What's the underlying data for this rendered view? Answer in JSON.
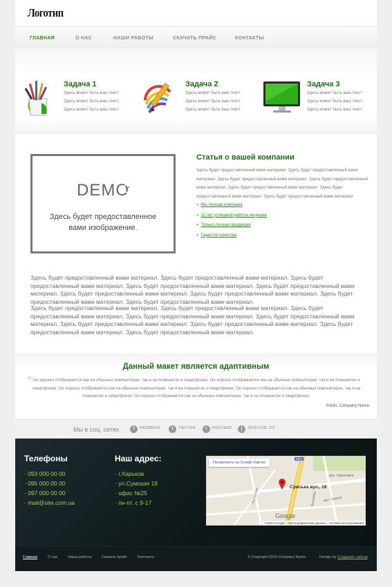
{
  "logo": "Логотип",
  "nav": [
    {
      "label": "ГЛАВНАЯ",
      "active": true
    },
    {
      "label": "О НАС"
    },
    {
      "label": "НАШИ РАБОТЫ"
    },
    {
      "label": "СКАЧАТЬ ПРАЙС"
    },
    {
      "label": "КОНТАКТЫ"
    }
  ],
  "tasks": [
    {
      "title": "Задача 1",
      "icon": "paintbrushes-icon",
      "lines": [
        "Здесь может быть ваш текст",
        "Здесь может быть ваш текст",
        "Здесь может быть ваш текст"
      ]
    },
    {
      "title": "Задача 2",
      "icon": "pencil-palette-icon",
      "lines": [
        "Здесь может быть ваш текст",
        "Здесь может быть ваш текст",
        "Здесь может быть ваш текст"
      ]
    },
    {
      "title": "Задача 3",
      "icon": "monitor-icon",
      "lines": [
        "Здесь может быть ваш текст",
        "Здесь может быть ваш текст",
        "Здесь может быть ваш текст"
      ]
    }
  ],
  "demo": {
    "word": "DEMO",
    "caption_1": "Здесь будет предоставленное",
    "caption_2": "вами изображение."
  },
  "article": {
    "title": "Статья о вашей компании",
    "text": "Здесь будет предоставленный вами материал. Здесь будет предоставленный вами материал. Здесь будет предоставленный вами материал. Здесь будет предоставленный вами материал. Здесь будет предоставленный вами материал. Здесь будет предоставленный вами материал. Здесь будет предоставленный вами материал.",
    "links": [
      "Мы лучшая компания",
      "12 лет успешной работы на рынке",
      "Только лучшая продукция",
      "Гарантия качества"
    ]
  },
  "paragraphs": [
    "Здесь будет предоставленный вами материал. Здесь будет предоставленный вами материал. Здесь будет предоставленный вами материал. Здесь будет предоставленный вами материал. Здесь будет предоставленный вами материал. Здесь будет предоставленный вами материал. Здесь будет предоставленный вами материал. Здесь будет предоставленный вами материал. Здесь будет предоставленный вами материал.",
    "Здесь будет предоставленный вами материал. Здесь будет предоставленный вами материал. Здесь будет предоставленный вами материал. Здесь будет предоставленный вами материал. Здесь будет предоставленный вами материал. Здесь будет предоставленный вами материал. Здесь будет предоставленный вами материал. Здесь будет предоставленный вами материал. Здесь будет предоставленный вами материал."
  ],
  "quote": {
    "title": "Данный макет является адаптивным",
    "text": "Он хорошо отображается как на обычных компьютерах, так и на планшетах и смартфонах. Он хорошо отображается как на обычных компьютерах, так и на планшетах и смартфонах. Он хорошо отображается как на обычных компьютерах, так и на планшетах и смартфонах. Он хорошо отображается как на обычных компьютерах, так и на планшетах и смартфонах. Он хорошо отображается как на обычных компьютерах, так и на планшетах и смартфонах.",
    "author": "Anton, Company Name"
  },
  "social": {
    "label": "Мы в соц. сетях",
    "items": [
      {
        "icon": "facebook-icon",
        "glyph": "f",
        "label": "FACEBOOK"
      },
      {
        "icon": "twitter-icon",
        "glyph": "t",
        "label": "TWITTER"
      },
      {
        "icon": "rss-icon",
        "glyph": "r",
        "label": "RSS-FEED"
      },
      {
        "icon": "user-icon",
        "glyph": "j",
        "label": "JOHN.DOE 123"
      }
    ]
  },
  "footer": {
    "phones_title": "Телефоны",
    "phones": [
      "093 000 00 00",
      "095 000 00 00",
      "097 000 00 00",
      "mail@site.com.ua"
    ],
    "address_title": "Наш адрес:",
    "address": [
      "г.Харьков",
      "ул.Сумская 19",
      "офис №25",
      "пн-пт. с 9-17"
    ],
    "map": {
      "link": "Посмотреть на Google Картах",
      "marker_label": "Сумська вул., 19",
      "attribution": "©2014 Google · Картографические данные · Условия использования",
      "google": "Google",
      "road_labels": [
        "Rymarska",
        "Gorodska",
        "вул. Скрипника",
        "вул. Гуцола",
        "М03"
      ]
    }
  },
  "bottom": {
    "links": [
      "Главная",
      "О нас",
      "Наши работы",
      "Скачать прайс",
      "Контакты"
    ],
    "copyright": "© Copyright 2014 Company Name",
    "design_by": "Design by",
    "design_link": "Создание сайтов"
  },
  "colors": {
    "accent": "#1b6e12",
    "link": "#2c8a1f",
    "footer_text": "#9bd24b",
    "footer_bg": "#0e1719"
  }
}
